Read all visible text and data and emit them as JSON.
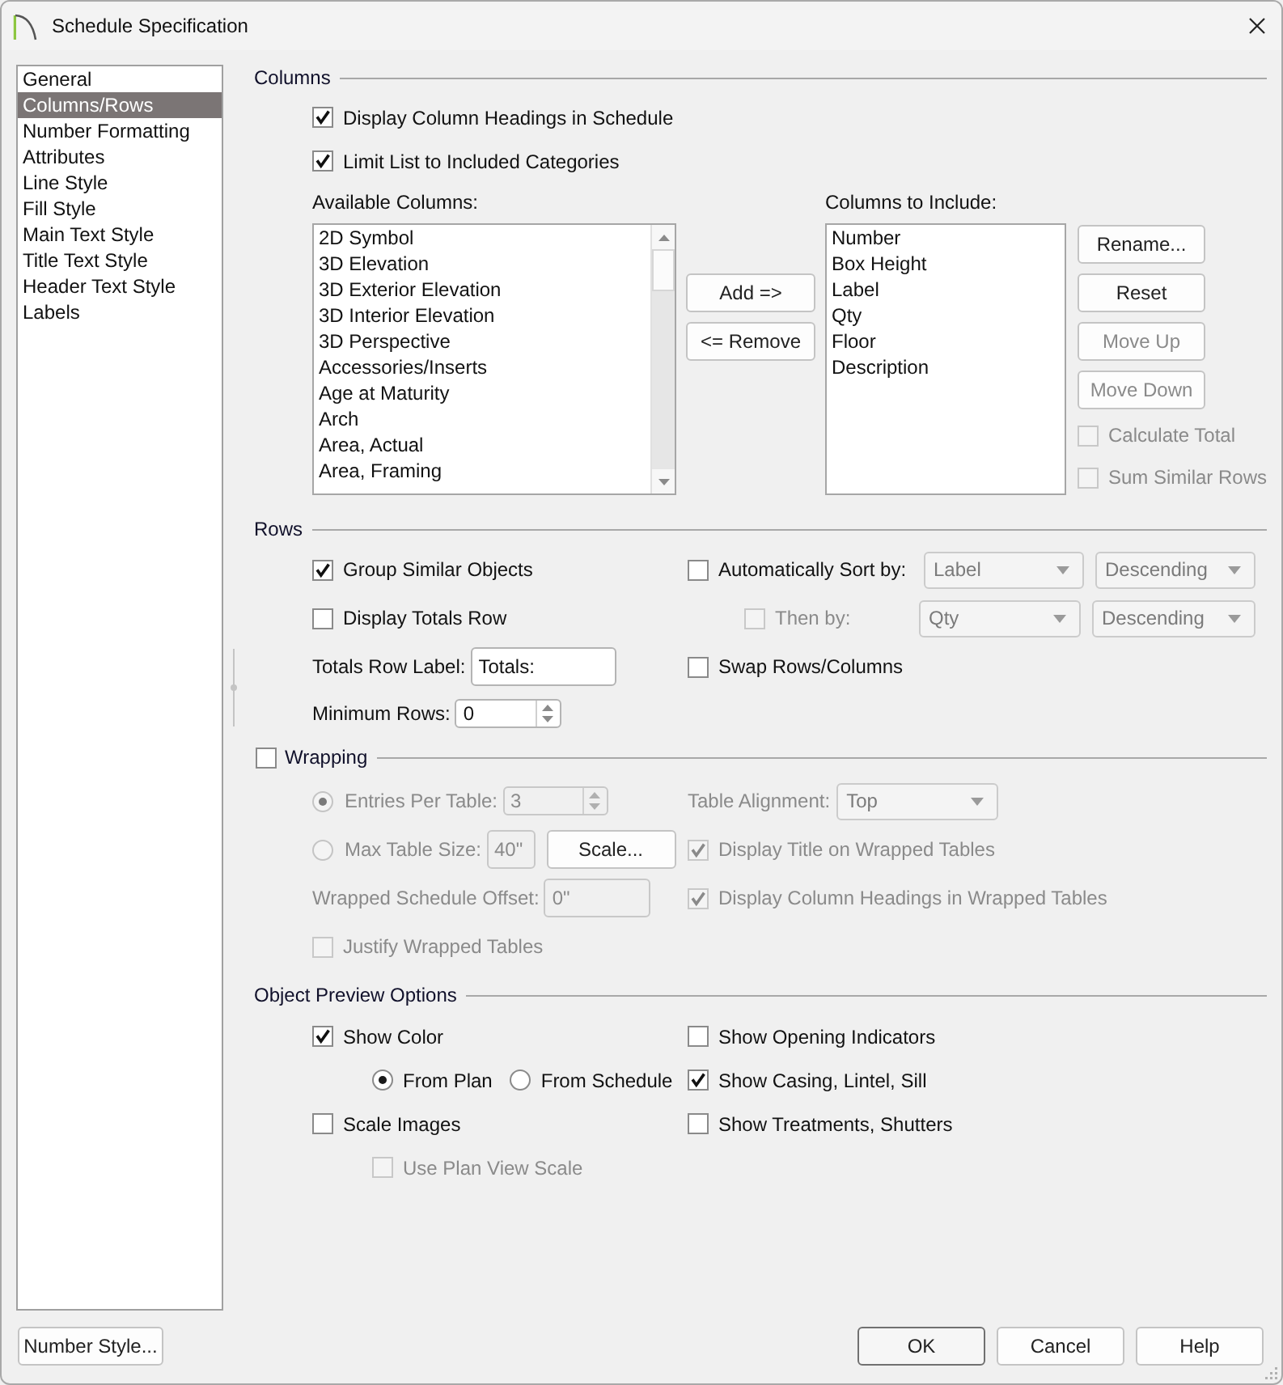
{
  "window": {
    "title": "Schedule Specification"
  },
  "sidebar": {
    "items": [
      {
        "label": "General",
        "selected": false
      },
      {
        "label": "Columns/Rows",
        "selected": true
      },
      {
        "label": "Number Formatting",
        "selected": false
      },
      {
        "label": "Attributes",
        "selected": false
      },
      {
        "label": "Line Style",
        "selected": false
      },
      {
        "label": "Fill Style",
        "selected": false
      },
      {
        "label": "Main Text Style",
        "selected": false
      },
      {
        "label": "Title Text Style",
        "selected": false
      },
      {
        "label": "Header Text Style",
        "selected": false
      },
      {
        "label": "Labels",
        "selected": false
      }
    ]
  },
  "columns": {
    "title": "Columns",
    "options": [
      {
        "label": "Display Column Headings in Schedule",
        "checked": true,
        "disabled": false
      },
      {
        "label": "Limit List to Included Categories",
        "checked": true,
        "disabled": false
      }
    ],
    "available": {
      "label": "Available Columns:",
      "items": [
        "2D Symbol",
        "3D Elevation",
        "3D Exterior Elevation",
        "3D Interior Elevation",
        "3D Perspective",
        "Accessories/Inserts",
        "Age at Maturity",
        "Arch",
        "Area, Actual",
        "Area, Framing"
      ]
    },
    "transfer_buttons": [
      {
        "label": "Add =>",
        "disabled": false
      },
      {
        "label": "<= Remove",
        "disabled": false
      }
    ],
    "included": {
      "label": "Columns to Include:",
      "items": [
        "Number",
        "Box Height",
        "Label",
        "Qty",
        "Floor",
        "Description"
      ]
    },
    "actions": [
      {
        "label": "Rename...",
        "disabled": false
      },
      {
        "label": "Reset",
        "disabled": false
      },
      {
        "label": "Move Up",
        "disabled": true
      },
      {
        "label": "Move Down",
        "disabled": true
      }
    ],
    "totals_options": [
      {
        "label": "Calculate Total",
        "checked": false,
        "disabled": true
      },
      {
        "label": "Sum Similar Rows",
        "checked": false,
        "disabled": true
      }
    ]
  },
  "rows": {
    "title": "Rows",
    "group_similar": {
      "label": "Group Similar Objects",
      "checked": true,
      "disabled": false
    },
    "auto_sort": {
      "label": "Automatically Sort by:",
      "checked": false,
      "disabled": false,
      "sort_field": {
        "value": "Label",
        "disabled": true
      },
      "sort_order": {
        "value": "Descending",
        "disabled": true
      }
    },
    "display_totals": {
      "label": "Display Totals Row",
      "checked": false,
      "disabled": false
    },
    "then_by": {
      "label": "Then by:",
      "checked": false,
      "disabled": true,
      "sort_field": {
        "value": "Qty",
        "disabled": true
      },
      "sort_order": {
        "value": "Descending",
        "disabled": true
      }
    },
    "totals_label": {
      "label": "Totals Row Label:",
      "value": "Totals:",
      "disabled": false
    },
    "swap": {
      "label": "Swap Rows/Columns",
      "checked": false,
      "disabled": false
    },
    "minimum_rows": {
      "label": "Minimum Rows:",
      "value": "0",
      "disabled": false
    }
  },
  "wrapping": {
    "title": "Wrapping",
    "checked": false,
    "disabled": false,
    "entries_per_table": {
      "label": "Entries Per Table:",
      "selected": true,
      "disabled": true,
      "value": "3"
    },
    "table_alignment": {
      "label": "Table Alignment:",
      "value": "Top",
      "disabled": true
    },
    "max_table_size": {
      "label": "Max Table Size:",
      "selected": false,
      "disabled": true,
      "value": "40\""
    },
    "scale_button": {
      "label": "Scale...",
      "disabled": false
    },
    "display_title": {
      "label": "Display Title on Wrapped Tables",
      "checked": true,
      "disabled": true
    },
    "offset": {
      "label": "Wrapped Schedule Offset:",
      "value": "0\"",
      "disabled": true
    },
    "display_headings": {
      "label": "Display Column Headings in Wrapped Tables",
      "checked": true,
      "disabled": true
    },
    "justify": {
      "label": "Justify Wrapped Tables",
      "checked": false,
      "disabled": true
    }
  },
  "preview": {
    "title": "Object Preview Options",
    "show_color": {
      "label": "Show Color",
      "checked": true,
      "disabled": false
    },
    "show_opening_indicators": {
      "label": "Show Opening Indicators",
      "checked": false,
      "disabled": false
    },
    "color_source": [
      {
        "label": "From Plan",
        "selected": true,
        "disabled": false
      },
      {
        "label": "From Schedule",
        "selected": false,
        "disabled": false
      }
    ],
    "show_casing": {
      "label": "Show Casing, Lintel, Sill",
      "checked": true,
      "disabled": false
    },
    "scale_images": {
      "label": "Scale Images",
      "checked": false,
      "disabled": false
    },
    "show_treatments": {
      "label": "Show Treatments, Shutters",
      "checked": false,
      "disabled": false
    },
    "use_plan_view_scale": {
      "label": "Use Plan View Scale",
      "checked": false,
      "disabled": true
    }
  },
  "number_style_button": {
    "label": "Number Style..."
  },
  "buttons": [
    {
      "label": "OK",
      "default": true
    },
    {
      "label": "Cancel",
      "default": false
    },
    {
      "label": "Help",
      "default": false
    }
  ]
}
